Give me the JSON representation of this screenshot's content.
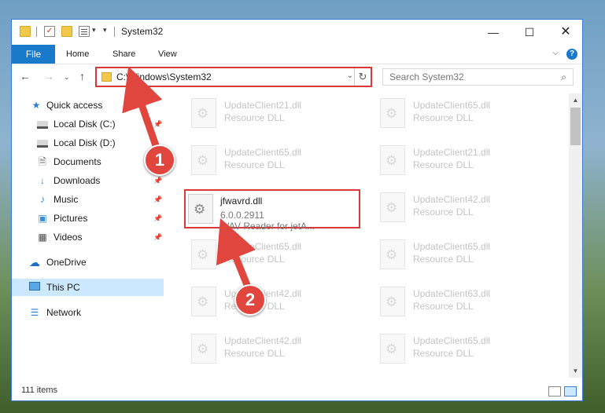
{
  "window": {
    "title": "System32"
  },
  "titlebar": {
    "minimize_icon": "minimize-icon",
    "maximize_icon": "maximize-icon",
    "close_icon": "close-icon"
  },
  "ribbon": {
    "tabs": [
      "File",
      "Home",
      "Share",
      "View"
    ]
  },
  "address": {
    "path": "C:\\Windows\\System32"
  },
  "search": {
    "placeholder": "Search System32"
  },
  "nav": {
    "items": [
      {
        "label": "Quick access",
        "icon": "star-icon"
      },
      {
        "label": "Local Disk (C:)",
        "icon": "drive-icon",
        "pinned": true
      },
      {
        "label": "Local Disk (D:)",
        "icon": "drive-icon"
      },
      {
        "label": "Documents",
        "icon": "documents-icon",
        "pinned": true
      },
      {
        "label": "Downloads",
        "icon": "download-icon",
        "pinned": true
      },
      {
        "label": "Music",
        "icon": "music-icon",
        "pinned": true
      },
      {
        "label": "Pictures",
        "icon": "pictures-icon",
        "pinned": true
      },
      {
        "label": "Videos",
        "icon": "videos-icon",
        "pinned": true
      },
      {
        "label": "OneDrive",
        "icon": "cloud-icon"
      },
      {
        "label": "This PC",
        "icon": "computer-icon",
        "selected": true
      },
      {
        "label": "Network",
        "icon": "network-icon"
      }
    ]
  },
  "files": {
    "left": [
      {
        "name": "UpdateClient21.dll",
        "type": "Resource DLL"
      },
      {
        "name": "UpdateClient65.dll",
        "type": "Resource DLL"
      },
      {
        "name": "jfwavrd.dll",
        "version": "6.0.0.2911",
        "description": "WAV Reader for jetA..."
      },
      {
        "name": "UpdateClient65.dll",
        "type": "Resource DLL"
      },
      {
        "name": "UpdateClient42.dll",
        "type": "Resource DLL"
      },
      {
        "name": "UpdateClient42.dll",
        "type": "Resource DLL"
      }
    ],
    "right": [
      {
        "name": "UpdateClient65.dll",
        "type": "Resource DLL"
      },
      {
        "name": "UpdateClient21.dll",
        "type": "Resource DLL"
      },
      {
        "name": "UpdateClient42.dll",
        "type": "Resource DLL"
      },
      {
        "name": "UpdateClient65.dll",
        "type": "Resource DLL"
      },
      {
        "name": "UpdateClient63.dll",
        "type": "Resource DLL"
      },
      {
        "name": "UpdateClient65.dll",
        "type": "Resource DLL"
      }
    ]
  },
  "status": {
    "count": "111 items"
  },
  "callouts": {
    "one": "1",
    "two": "2",
    "color": "#e0463e"
  },
  "colors": {
    "accent": "#1979ca",
    "highlight": "#d9393b",
    "selection": "#cce8ff"
  }
}
